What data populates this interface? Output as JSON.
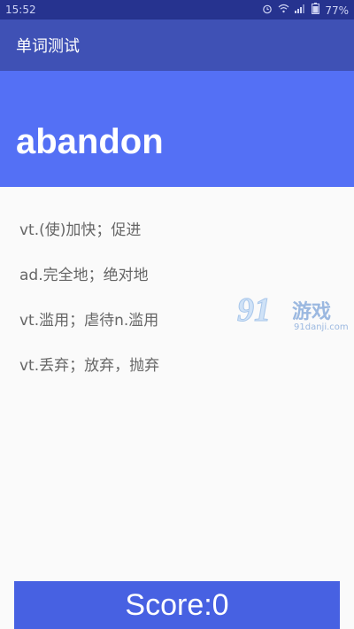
{
  "status_bar": {
    "time": "15:52",
    "battery": "77%",
    "icons": [
      "alarm-icon",
      "wifi-icon",
      "signal-icon",
      "battery-icon"
    ]
  },
  "app_bar": {
    "title": "单词测试"
  },
  "word": {
    "text": "abandon"
  },
  "options": [
    {
      "label": "vt.(使)加快；促进"
    },
    {
      "label": "ad.完全地；绝对地"
    },
    {
      "label": "vt.滥用；虐待n.滥用"
    },
    {
      "label": "vt.丢弃；放弃，抛弃"
    }
  ],
  "watermark": {
    "logo": "91",
    "name": "游戏",
    "domain": "91danji.com"
  },
  "score": {
    "label": "Score:0"
  },
  "colors": {
    "status_bar": "#26338f",
    "app_bar": "#3f51b5",
    "word_header": "#5470f5",
    "score_bar": "#4761e2",
    "option_text": "#666666"
  }
}
